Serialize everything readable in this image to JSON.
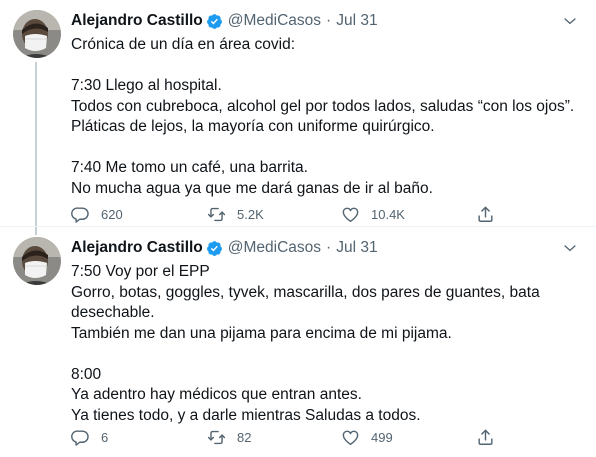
{
  "colors": {
    "text": "#0f1419",
    "muted": "#536471",
    "verified": "#1d9bf0",
    "thread_line": "#c4cfd6"
  },
  "tweets": [
    {
      "author": {
        "name": "Alejandro Castillo",
        "verified_icon": "verified-badge-icon",
        "handle": "@MediCasos",
        "separator": "·",
        "date": "Jul 31",
        "avatar_icon": "avatar-photo"
      },
      "paragraphs": [
        "Crónica de un día en área covid:",
        "7:30 Llego al hospital.\nTodos con cubreboca, alcohol gel por todos lados, saludas “con los ojos”.\nPláticas de lejos, la mayoría con uniforme quirúrgico.",
        "7:40 Me tomo un café, una barrita.\nNo mucha agua ya que me dará ganas de ir al baño."
      ],
      "actions": {
        "replies": "620",
        "retweets": "5.2K",
        "likes": "10.4K"
      }
    },
    {
      "author": {
        "name": "Alejandro Castillo",
        "verified_icon": "verified-badge-icon",
        "handle": "@MediCasos",
        "separator": "·",
        "date": "Jul 31",
        "avatar_icon": "avatar-photo"
      },
      "paragraphs": [
        "7:50 Voy por el EPP\nGorro, botas, goggles, tyvek, mascarilla, dos pares de guantes, bata desechable.\nTambién me dan una pijama para encima de mi pijama.",
        "8:00\nYa adentro hay médicos que entran antes.\nYa tienes todo, y a darle mientras Saludas a todos."
      ],
      "actions": {
        "replies": "6",
        "retweets": "82",
        "likes": "499"
      }
    }
  ]
}
